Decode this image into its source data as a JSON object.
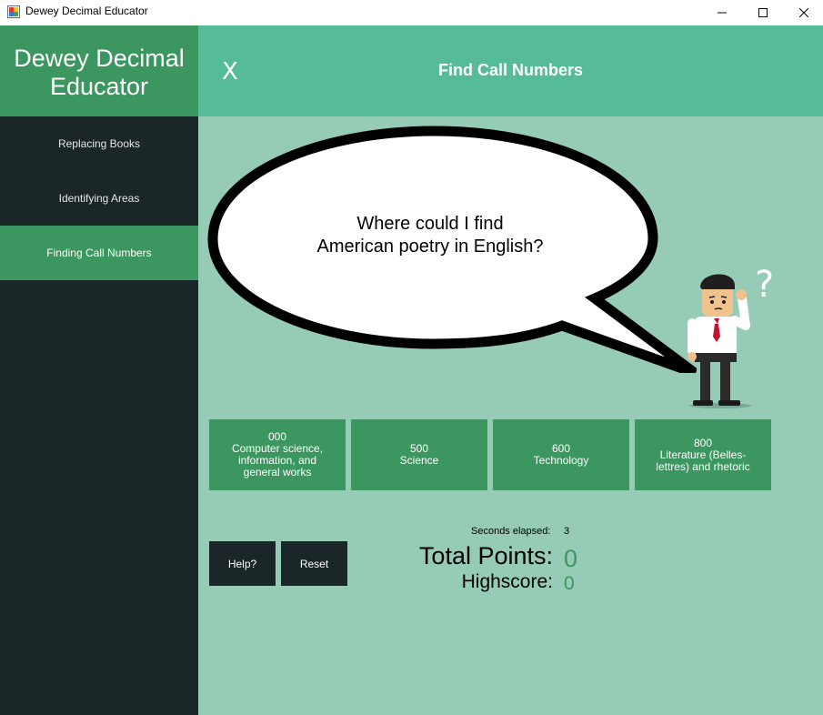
{
  "window": {
    "title": "Dewey Decimal Educator",
    "icon": "app-window-icon",
    "controls": [
      "minimize-icon",
      "maximize-icon",
      "close-icon"
    ]
  },
  "sidebar": {
    "brand": "Dewey Decimal Educator",
    "items": [
      {
        "label": "Replacing Books",
        "active": false
      },
      {
        "label": "Identifying Areas",
        "active": false
      },
      {
        "label": "Finding Call Numbers",
        "active": true
      }
    ]
  },
  "header": {
    "close_label": "X",
    "title": "Find Call Numbers"
  },
  "question": {
    "line1": "Where could I find",
    "line2": "American poetry in English?"
  },
  "choices": [
    {
      "code": "000",
      "name": "Computer science, information, and general works"
    },
    {
      "code": "500",
      "name": "Science"
    },
    {
      "code": "600",
      "name": "Technology"
    },
    {
      "code": "800",
      "name": "Literature (Belles-lettres) and rhetoric"
    }
  ],
  "actions": {
    "help_label": "Help?",
    "reset_label": "Reset"
  },
  "stats": {
    "seconds_label": "Seconds elapsed:",
    "seconds_value": "3",
    "points_label": "Total Points:",
    "points_value": "0",
    "highscore_label": "Highscore:",
    "highscore_value": "0"
  },
  "colors": {
    "sidebar_bg": "#1b2629",
    "accent_green": "#3b9660",
    "header_bg": "#55bb99",
    "main_bg": "#96ccb6"
  }
}
